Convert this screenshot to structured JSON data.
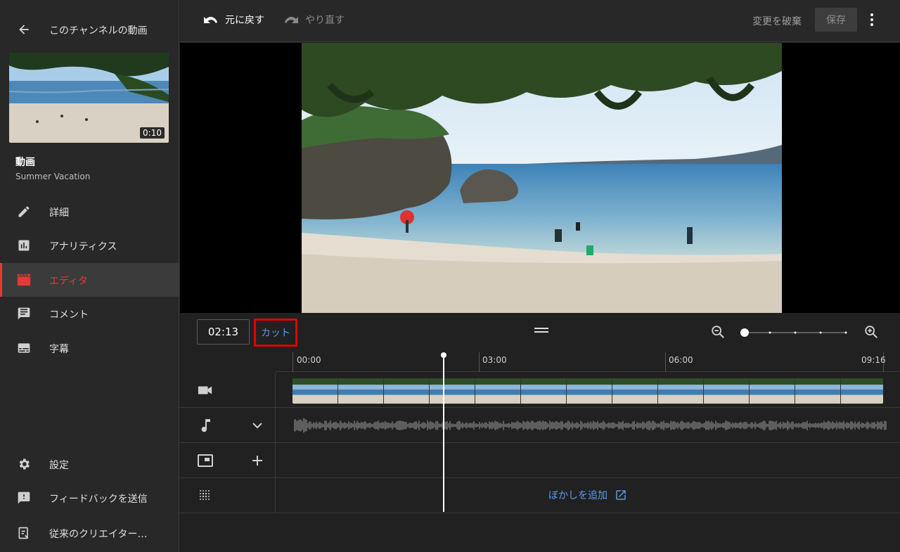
{
  "sidebar": {
    "title": "このチャンネルの動画",
    "thumbnail_duration": "0:10",
    "video_label": "動画",
    "video_name": "Summer Vacation",
    "nav": [
      {
        "label": "詳細",
        "icon": "pencil-icon"
      },
      {
        "label": "アナリティクス",
        "icon": "analytics-icon"
      },
      {
        "label": "エディタ",
        "icon": "clapperboard-icon",
        "active": true
      },
      {
        "label": "コメント",
        "icon": "comment-icon"
      },
      {
        "label": "字幕",
        "icon": "subtitles-icon"
      }
    ],
    "bottom_nav": [
      {
        "label": "設定",
        "icon": "gear-icon"
      },
      {
        "label": "フィードバックを送信",
        "icon": "feedback-icon"
      },
      {
        "label": "従来のクリエイター…",
        "icon": "classic-studio-icon"
      }
    ]
  },
  "toolbar": {
    "undo_label": "元に戻す",
    "redo_label": "やり直す",
    "discard_label": "変更を破棄",
    "save_label": "保存"
  },
  "timeline": {
    "current_time": "02:13",
    "cut_label": "カット",
    "ruler": [
      "00:00",
      "03:00",
      "06:00",
      "09:16"
    ],
    "blur_label": "ぼかしを追加"
  },
  "colors": {
    "accent_red": "#e53935",
    "link_blue": "#5b9bf0",
    "highlight_box": "#e00000"
  }
}
